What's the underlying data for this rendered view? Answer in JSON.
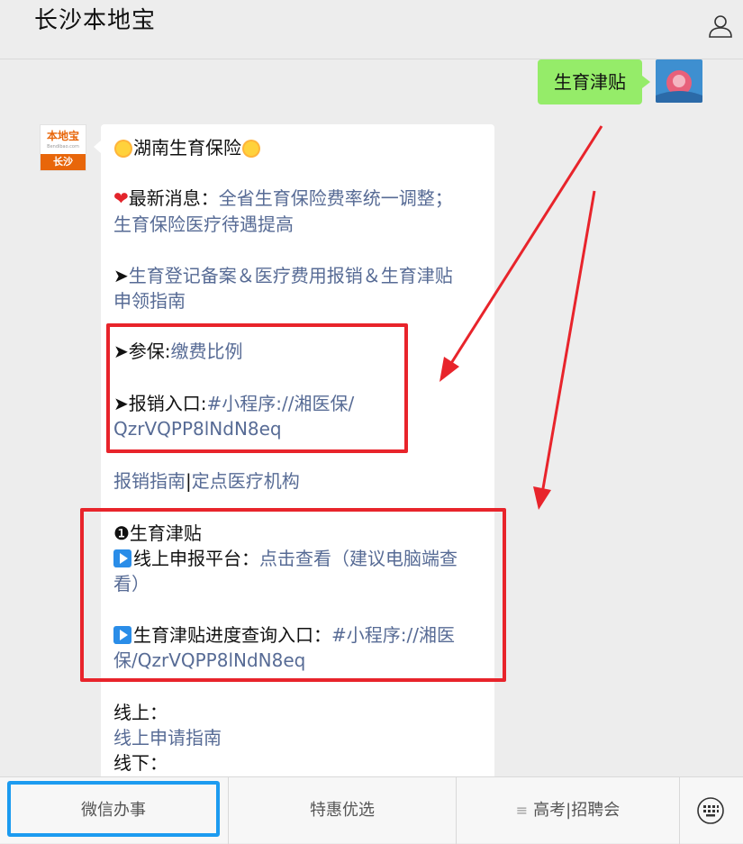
{
  "header": {
    "title": "长沙本地宝",
    "profile_icon": "user-icon"
  },
  "chat": {
    "user_message": "生育津贴",
    "bot_avatar": {
      "brand": "本地宝",
      "url": "Bendibao.com",
      "city": "长沙"
    },
    "lines": {
      "title": "湖南生育保险",
      "news_label": "最新消息：",
      "news_link_1": "全省生育保险费率统一调整；",
      "news_link_2": "生育保险医疗待遇提高",
      "guide_prefix": "➤",
      "guide_link_1": "生育登记备案＆医疗费用报销＆生育津贴",
      "guide_link_2": "申领指南",
      "insure_label": "➤参保:",
      "insure_link": "缴费比例",
      "reimburse_label": "➤报销入口:",
      "reimburse_link_1": "#小程序://湘医保/",
      "reimburse_link_2": "QzrVQPP8lNdN8eq",
      "reimburse_guide": "报销指南",
      "separator": "|",
      "designated_hospitals": "定点医疗机构",
      "allowance_title": "❶生育津贴",
      "online_platform_label": "线上申报平台：",
      "online_platform_link_1": "点击查看（建议电脑端查",
      "online_platform_link_2": "看）",
      "progress_label": "生育津贴进度查询入口：",
      "progress_link_1": "#小程序://湘医",
      "progress_link_2": "保/QzrVQPP8lNdN8eq",
      "online_label": "线上：",
      "online_guide_link": "线上申请指南",
      "offline_label": "线下："
    }
  },
  "bottom_bar": {
    "tabs": [
      "微信办事",
      "特惠优选",
      "高考|招聘会"
    ],
    "keyboard_icon": "keyboard-icon"
  },
  "colors": {
    "link": "#576b95",
    "highlight_red": "#e8242b",
    "tab_outline_blue": "#1c9bf0",
    "user_bubble": "#95ec69"
  }
}
